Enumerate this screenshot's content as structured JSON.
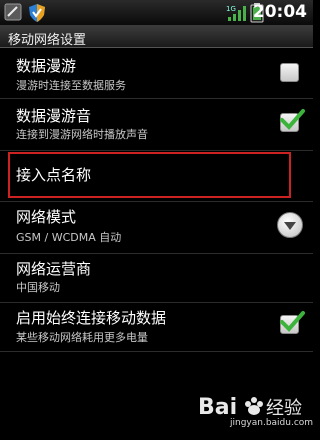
{
  "status_bar": {
    "time": "20:04",
    "icons": [
      "usb-icon",
      "shield-icon",
      "signal-icon",
      "battery-icon"
    ]
  },
  "title_bar": {
    "title": "移动网络设置"
  },
  "settings": [
    {
      "title": "数据漫游",
      "subtitle": "漫游时连接至数据服务",
      "control": "checkbox",
      "checked": false
    },
    {
      "title": "数据漫游音",
      "subtitle": "连接到漫游网络时播放声音",
      "control": "checkbox",
      "checked": true
    },
    {
      "title": "接入点名称",
      "subtitle": "",
      "control": "none",
      "highlighted": true
    },
    {
      "title": "网络模式",
      "subtitle": "GSM / WCDMA 自动",
      "control": "dropdown"
    },
    {
      "title": "网络运营商",
      "subtitle": "中国移动",
      "control": "none"
    },
    {
      "title": "启用始终连接移动数据",
      "subtitle": "某些移动网络耗用更多电量",
      "control": "checkbox",
      "checked": true
    }
  ],
  "watermark": {
    "brand": "Bai 经验",
    "url": "jingyan.baidu.com"
  },
  "colors": {
    "accent_check": "#3cb43c",
    "highlight_box": "#cc2222"
  }
}
